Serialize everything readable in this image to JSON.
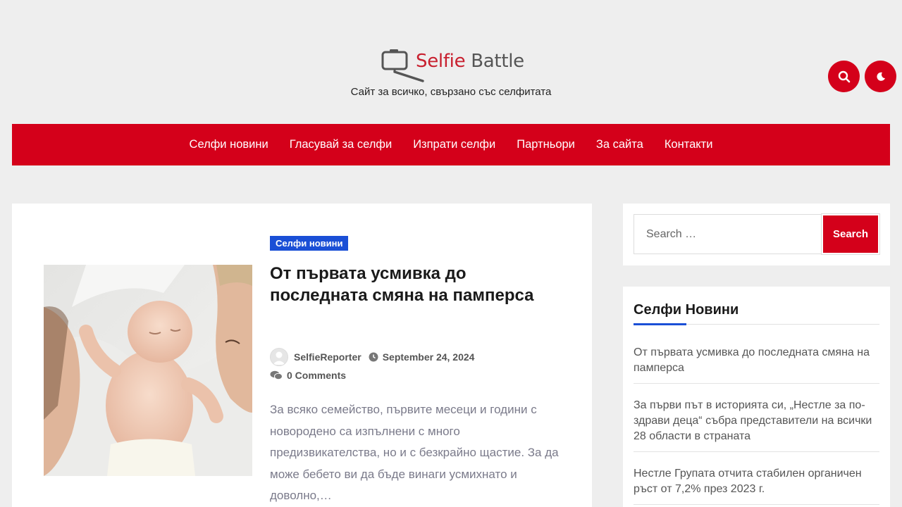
{
  "header": {
    "logo_word1": "Selfie",
    "logo_word2": "Battle",
    "tagline": "Сайт за всичко, свързано със селфитата",
    "search_icon": "search-icon",
    "theme_icon": "moon-icon"
  },
  "nav": {
    "items": [
      {
        "label": "Селфи новини"
      },
      {
        "label": "Гласувай за селфи"
      },
      {
        "label": "Изпрати селфи"
      },
      {
        "label": "Партньори"
      },
      {
        "label": "За сайта"
      },
      {
        "label": "Контакти"
      }
    ]
  },
  "post": {
    "category": "Селфи новини",
    "title": "От първата усмивка до последната смяна на памперса",
    "author": "SelfieReporter",
    "date": "September 24, 2024",
    "comments": "0 Comments",
    "excerpt": "За всяко семейство, първите месеци и години с новородено са изпълнени с много предизвикателства, но и с безкрайно щастие. За да може бебето ви да бъде винаги усмихнато и доволно,…"
  },
  "sidebar": {
    "search_placeholder": "Search …",
    "search_button": "Search",
    "widget_title": "Селфи Новини",
    "news": [
      {
        "title": "От първата усмивка до последната смяна на памперса"
      },
      {
        "title": "За първи път в историята си, „Нестле за по-здрави деца“ събра представители на всички 28 области в страната"
      },
      {
        "title": "Нестле Групата отчита стабилен органичен ръст от 7,2% през 2023 г."
      }
    ]
  },
  "colors": {
    "brand_red": "#d4001a",
    "badge_blue": "#1a4fd6",
    "background": "#eeeeee"
  }
}
